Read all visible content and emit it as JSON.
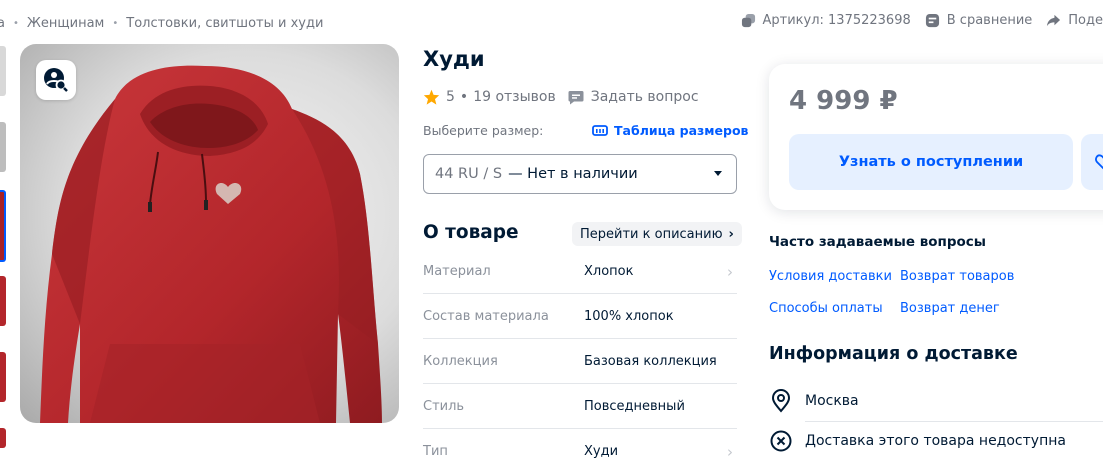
{
  "breadcrumbs": {
    "first": "а",
    "items": [
      "Женщинам",
      "Толстовки, свитшоты и худи"
    ],
    "separator": "•"
  },
  "top_actions": {
    "article": "Артикул: 1375223698",
    "compare": "В сравнение",
    "share": "Поде"
  },
  "product": {
    "title": "Худи",
    "rating": "5",
    "reviews": "19 отзывов",
    "rating_separator": "•",
    "ask_question": "Задать вопрос",
    "image_icon": "image-search-icon",
    "color_main": "#b3262b"
  },
  "size": {
    "label": "Выберите размер:",
    "table_link": "Таблица размеров",
    "selected_size": "44 RU / S",
    "selected_status": "— Нет в наличии"
  },
  "about": {
    "title": "О товаре",
    "goto_description": "Перейти к описанию",
    "properties": [
      {
        "key": "Материал",
        "value": "Хлопок"
      },
      {
        "key": "Состав материала",
        "value": "100% хлопок"
      },
      {
        "key": "Коллекция",
        "value": "Базовая коллекция"
      },
      {
        "key": "Стиль",
        "value": "Повседневный"
      },
      {
        "key": "Тип",
        "value": "Худи"
      }
    ]
  },
  "buy_card": {
    "price": "4 999 ₽",
    "notify_button": "Узнать о поступлении"
  },
  "faq": {
    "title": "Часто задаваемые вопросы",
    "links": [
      "Условия доставки",
      "Возврат товаров",
      "Способы оплаты",
      "Возврат денег"
    ]
  },
  "delivery": {
    "title": "Информация о доставке",
    "city": "Москва",
    "unavailable": "Доставка этого товара недоступна"
  },
  "colors": {
    "accent": "#005bff",
    "text": "#001a34",
    "muted": "#70757f",
    "star": "#ffa800"
  }
}
